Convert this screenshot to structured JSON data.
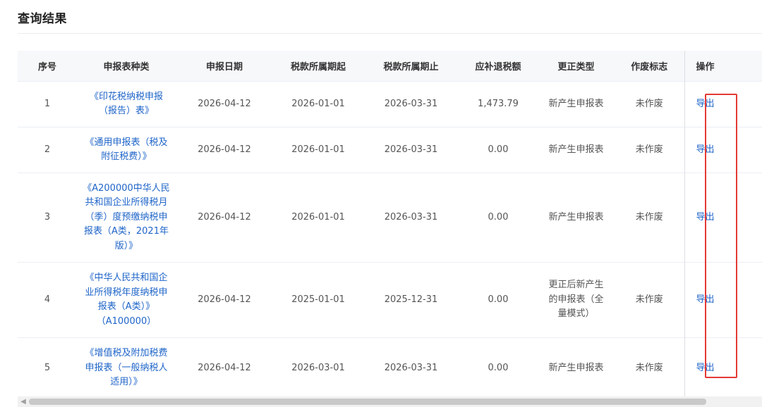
{
  "title": "查询结果",
  "columns": [
    "序号",
    "申报表种类",
    "申报日期",
    "税款所属期起",
    "税款所属期止",
    "应补退税额",
    "更正类型",
    "作废标志",
    "操作"
  ],
  "rows": [
    {
      "index": "1",
      "form_name": "《印花税纳税申报（报告）表》",
      "filing_date": "2026-04-12",
      "period_start": "2026-01-01",
      "period_end": "2026-03-31",
      "tax_amount": "1,473.79",
      "correction_type": "新产生申报表",
      "void_flag": "未作废",
      "action": "导出"
    },
    {
      "index": "2",
      "form_name": "《通用申报表（税及附征税费）》",
      "filing_date": "2026-04-12",
      "period_start": "2026-01-01",
      "period_end": "2026-03-31",
      "tax_amount": "0.00",
      "correction_type": "新产生申报表",
      "void_flag": "未作废",
      "action": "导出"
    },
    {
      "index": "3",
      "form_name": "《A200000中华人民共和国企业所得税月（季）度预缴纳税申报表（A类，2021年版）》",
      "filing_date": "2026-04-12",
      "period_start": "2026-01-01",
      "period_end": "2026-03-31",
      "tax_amount": "0.00",
      "correction_type": "新产生申报表",
      "void_flag": "未作废",
      "action": "导出"
    },
    {
      "index": "4",
      "form_name": "《中华人民共和国企业所得税年度纳税申报表（A类）》（A100000）",
      "filing_date": "2026-04-12",
      "period_start": "2025-01-01",
      "period_end": "2025-12-31",
      "tax_amount": "0.00",
      "correction_type": "更正后新产生的申报表（全量模式）",
      "void_flag": "未作废",
      "action": "导出"
    },
    {
      "index": "5",
      "form_name": "《增值税及附加税费申报表（一般纳税人适用）》",
      "filing_date": "2026-04-12",
      "period_start": "2026-03-01",
      "period_end": "2026-03-31",
      "tax_amount": "0.00",
      "correction_type": "新产生申报表",
      "void_flag": "未作废",
      "action": "导出"
    }
  ],
  "colors": {
    "link": "#1e64c8",
    "header_bg": "#f7f8fa",
    "highlight": "#e53935"
  },
  "icons": {
    "scroll_left": "chevron-left-icon"
  }
}
